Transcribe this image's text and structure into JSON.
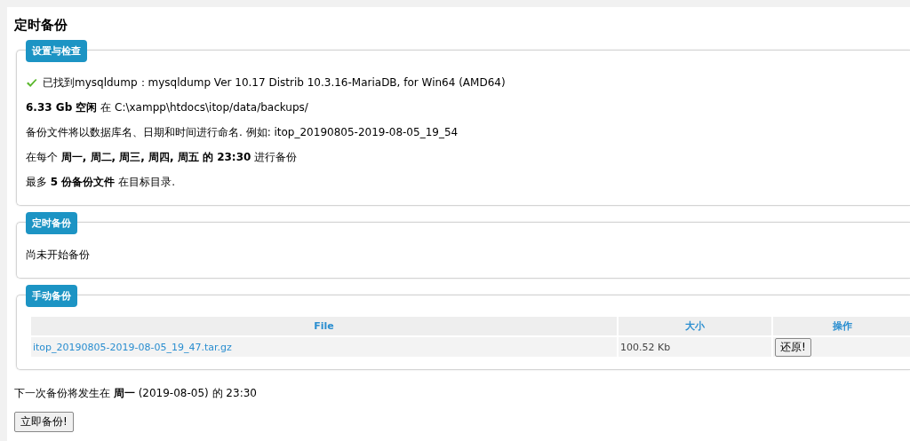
{
  "title": "定时备份",
  "sections": [
    {
      "legend": "设置与检查",
      "kind": "lines",
      "lines": [
        {
          "kind": "success",
          "text": "已找到mysqldump：mysqldump Ver 10.17 Distrib 10.3.16-MariaDB, for Win64 (AMD64)"
        },
        {
          "kind": "plain",
          "text": "**6.33 Gb 空闲** 在 C:\\xampp\\htdocs\\itop/data/backups/"
        },
        {
          "kind": "plain",
          "text": "备份文件将以数据库名、日期和时间进行命名. 例如: itop_20190805-2019-08-05_19_54"
        },
        {
          "kind": "plain",
          "text": "在每个 **周一, 周二, 周三, 周四, 周五 的 23:30** 进行备份"
        },
        {
          "kind": "plain",
          "text": "最多 **5 份备份文件** 在目标目录."
        }
      ]
    },
    {
      "legend": "定时备份",
      "kind": "lines",
      "lines": [
        {
          "kind": "plain",
          "text": "尚未开始备份"
        }
      ]
    },
    {
      "legend": "手动备份",
      "kind": "table",
      "columns": [
        "File",
        "大小",
        "操作"
      ],
      "rows": [
        {
          "file": "itop_20190805-2019-08-05_19_47.tar.gz",
          "size": "100.52 Kb",
          "action": "还原!"
        }
      ]
    }
  ],
  "next_backup": "下一次备份将发生在 **周一** (2019-08-05) 的 23:30",
  "backup_button": "立即备份!"
}
